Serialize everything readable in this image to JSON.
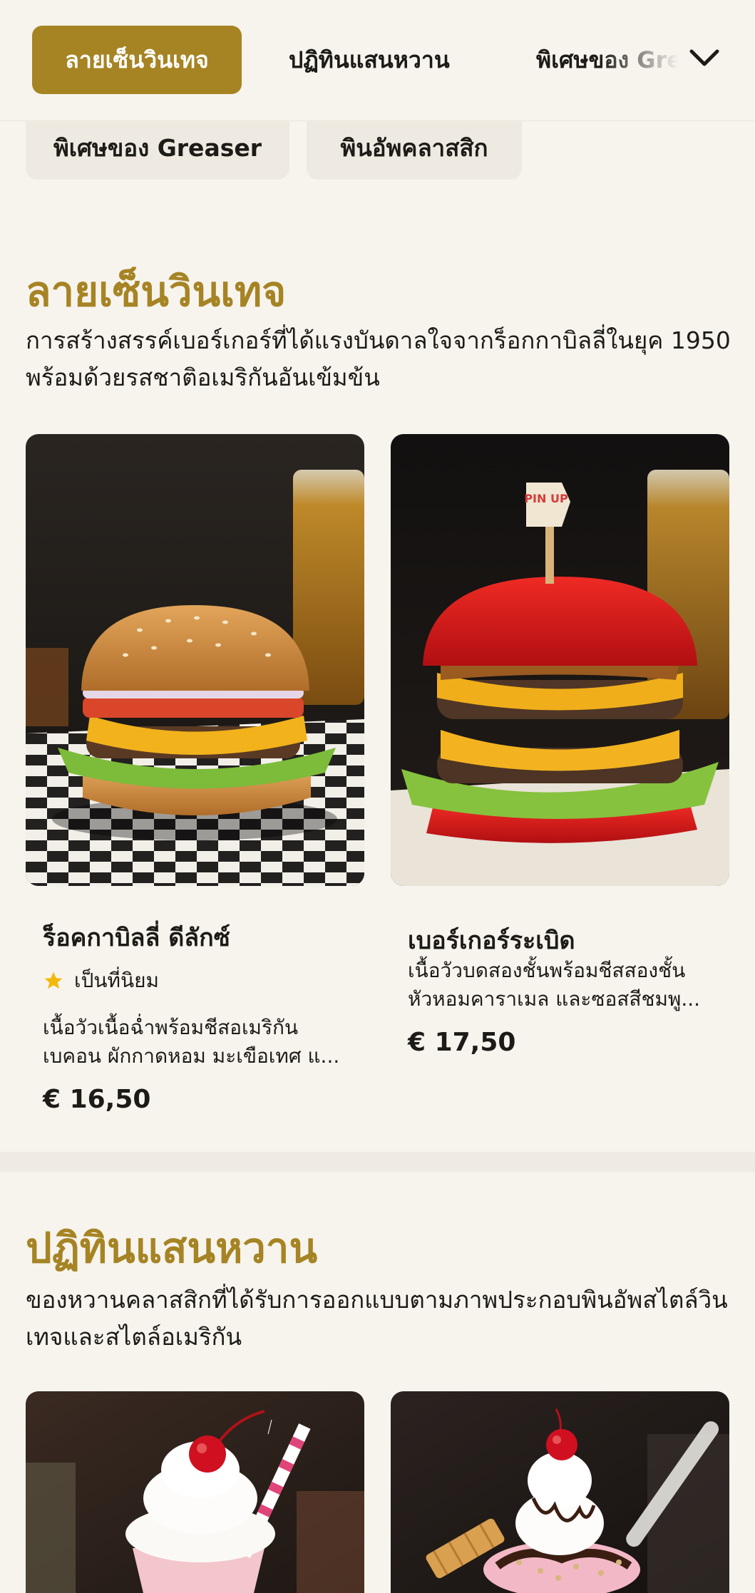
{
  "nav": {
    "tabs": [
      {
        "label": "ลายเซ็นวินเทจ",
        "active": true
      },
      {
        "label": "ปฏิทินแสนหวาน",
        "active": false
      },
      {
        "label": "พิเศษของ Greaser",
        "active": false
      }
    ],
    "more_icon": "chevron-down-icon",
    "chips": [
      "พิเศษของ Greaser",
      "พินอัพคลาสสิก"
    ]
  },
  "sections": [
    {
      "title": "ลายเซ็นวินเทจ",
      "description": "การสร้างสรรค์เบอร์เกอร์ที่ได้แรงบันดาลใจจากร็อกกาบิลลี่ในยุค 1950 พร้อมด้วยรสชาติอเมริกันอันเข้มข้น",
      "items": [
        {
          "name": "ร็อคกาบิลลี่ ดีลักซ์",
          "badge": "เป็นที่นิยม",
          "description": "เนื้อวัวเนื้อฉ่ำพร้อมชีสอเมริกัน เบคอน ผักกาดหอม มะเขือเทศ แ...",
          "price": "€ 16,50"
        },
        {
          "name": "เบอร์เกอร์ระเบิด",
          "description": "เนื้อวัวบดสองชั้นพร้อมชีสสองชั้น หัวหอมคาราเมล และซอสสีชมพู...",
          "price": "€ 17,50",
          "flag_text": "PIN UP"
        }
      ]
    },
    {
      "title": "ปฏิทินแสนหวาน",
      "description": "ของหวานคลาสสิกที่ได้รับการออกแบบตามภาพประกอบพินอัพสไตล์วินเทจและสไตล์อเมริกัน"
    }
  ],
  "colors": {
    "accent": "#a68424",
    "background": "#f7f4ee",
    "star": "#f2b90c"
  }
}
